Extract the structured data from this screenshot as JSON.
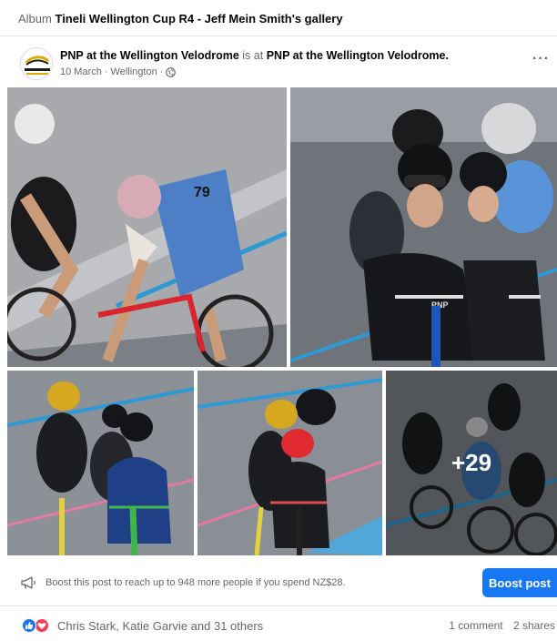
{
  "album": {
    "prefix": "Album",
    "title": "Tineli Wellington Cup R4 - Jeff Mein Smith's gallery"
  },
  "post": {
    "page_name": "PNP at the Wellington Velodrome",
    "is_at": "is at",
    "location_name": "PNP at the Wellington Velodrome.",
    "date": "10 March",
    "separator": "·",
    "place": "Wellington",
    "avatar_text": "WELLINGTON VELODROME",
    "more_label": "···"
  },
  "photos": {
    "more_count": "+29",
    "items": [
      {
        "icon": "cyclist-photo",
        "number": "79"
      },
      {
        "icon": "cyclist-photo",
        "text": "PNP"
      },
      {
        "icon": "cyclist-photo"
      },
      {
        "icon": "cyclist-photo"
      },
      {
        "icon": "cyclist-photo"
      }
    ]
  },
  "boost": {
    "text": "Boost this post to reach up to 948 more people if you spend NZ$28.",
    "button_label": "Boost post"
  },
  "reactions": {
    "names": "Chris Stark, Katie Garvie and 31 others",
    "comments": "1 comment",
    "shares": "2 shares"
  },
  "colors": {
    "accent": "#1877f2",
    "love": "#f33e58",
    "muted_text": "#65676b",
    "track_blue": "#2d9ad6"
  }
}
